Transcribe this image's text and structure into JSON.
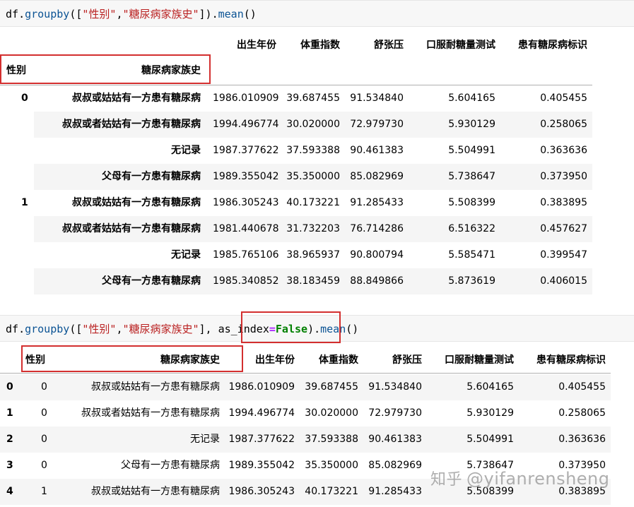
{
  "cell1": {
    "code": [
      {
        "t": "df",
        "c": "tok-name"
      },
      {
        "t": ".",
        "c": "tok-punc"
      },
      {
        "t": "groupby",
        "c": "tok-fn"
      },
      {
        "t": "([",
        "c": "tok-punc"
      },
      {
        "t": "\"性别\"",
        "c": "tok-str"
      },
      {
        "t": ",",
        "c": "tok-punc"
      },
      {
        "t": "\"糖尿病家族史\"",
        "c": "tok-str"
      },
      {
        "t": "]).",
        "c": "tok-punc"
      },
      {
        "t": "mean",
        "c": "tok-fn"
      },
      {
        "t": "()",
        "c": "tok-punc"
      }
    ]
  },
  "table1": {
    "columns": [
      "出生年份",
      "体重指数",
      "舒张压",
      "口服耐糖量测试",
      "患有糖尿病标识"
    ],
    "index_names": [
      "性别",
      "糖尿病家族史"
    ],
    "rows": [
      {
        "g": "0",
        "h": "叔叔或姑姑有一方患有糖尿病",
        "v": [
          "1986.010909",
          "39.687455",
          "91.534840",
          "5.604165",
          "0.405455"
        ]
      },
      {
        "g": "",
        "h": "叔叔或者姑姑有一方患有糖尿病",
        "v": [
          "1994.496774",
          "30.020000",
          "72.979730",
          "5.930129",
          "0.258065"
        ]
      },
      {
        "g": "",
        "h": "无记录",
        "v": [
          "1987.377622",
          "37.593388",
          "90.461383",
          "5.504991",
          "0.363636"
        ]
      },
      {
        "g": "",
        "h": "父母有一方患有糖尿病",
        "v": [
          "1989.355042",
          "35.350000",
          "85.082969",
          "5.738647",
          "0.373950"
        ]
      },
      {
        "g": "1",
        "h": "叔叔或姑姑有一方患有糖尿病",
        "v": [
          "1986.305243",
          "40.173221",
          "91.285433",
          "5.508399",
          "0.383895"
        ]
      },
      {
        "g": "",
        "h": "叔叔或者姑姑有一方患有糖尿病",
        "v": [
          "1981.440678",
          "31.732203",
          "76.714286",
          "6.516322",
          "0.457627"
        ]
      },
      {
        "g": "",
        "h": "无记录",
        "v": [
          "1985.765106",
          "38.965937",
          "90.800794",
          "5.585471",
          "0.399547"
        ]
      },
      {
        "g": "",
        "h": "父母有一方患有糖尿病",
        "v": [
          "1985.340852",
          "38.183459",
          "88.849866",
          "5.873619",
          "0.406015"
        ]
      }
    ]
  },
  "cell2": {
    "code": [
      {
        "t": "df",
        "c": "tok-name"
      },
      {
        "t": ".",
        "c": "tok-punc"
      },
      {
        "t": "groupby",
        "c": "tok-fn"
      },
      {
        "t": "([",
        "c": "tok-punc"
      },
      {
        "t": "\"性别\"",
        "c": "tok-str"
      },
      {
        "t": ",",
        "c": "tok-punc"
      },
      {
        "t": "\"糖尿病家族史\"",
        "c": "tok-str"
      },
      {
        "t": "], ",
        "c": "tok-punc"
      },
      {
        "t": "as_index",
        "c": "tok-name"
      },
      {
        "t": "=",
        "c": "tok-op"
      },
      {
        "t": "False",
        "c": "tok-kw"
      },
      {
        "t": ").",
        "c": "tok-punc"
      },
      {
        "t": "mean",
        "c": "tok-fn"
      },
      {
        "t": "()",
        "c": "tok-punc"
      }
    ]
  },
  "table2": {
    "columns": [
      "性别",
      "糖尿病家族史",
      "出生年份",
      "体重指数",
      "舒张压",
      "口服耐糖量测试",
      "患有糖尿病标识"
    ],
    "rows": [
      {
        "i": "0",
        "g": "0",
        "h": "叔叔或姑姑有一方患有糖尿病",
        "v": [
          "1986.010909",
          "39.687455",
          "91.534840",
          "5.604165",
          "0.405455"
        ]
      },
      {
        "i": "1",
        "g": "0",
        "h": "叔叔或者姑姑有一方患有糖尿病",
        "v": [
          "1994.496774",
          "30.020000",
          "72.979730",
          "5.930129",
          "0.258065"
        ]
      },
      {
        "i": "2",
        "g": "0",
        "h": "无记录",
        "v": [
          "1987.377622",
          "37.593388",
          "90.461383",
          "5.504991",
          "0.363636"
        ]
      },
      {
        "i": "3",
        "g": "0",
        "h": "父母有一方患有糖尿病",
        "v": [
          "1989.355042",
          "35.350000",
          "85.082969",
          "5.738647",
          "0.373950"
        ]
      },
      {
        "i": "4",
        "g": "1",
        "h": "叔叔或姑姑有一方患有糖尿病",
        "v": [
          "1986.305243",
          "40.173221",
          "91.285433",
          "5.508399",
          "0.383895"
        ]
      }
    ]
  },
  "watermark": {
    "logo": "知乎",
    "text": "@yifanrensheng"
  },
  "accent": {
    "highlight": "#d32f2f",
    "stripe": "#f5f5f5",
    "code_bg": "#f7f7f7"
  }
}
